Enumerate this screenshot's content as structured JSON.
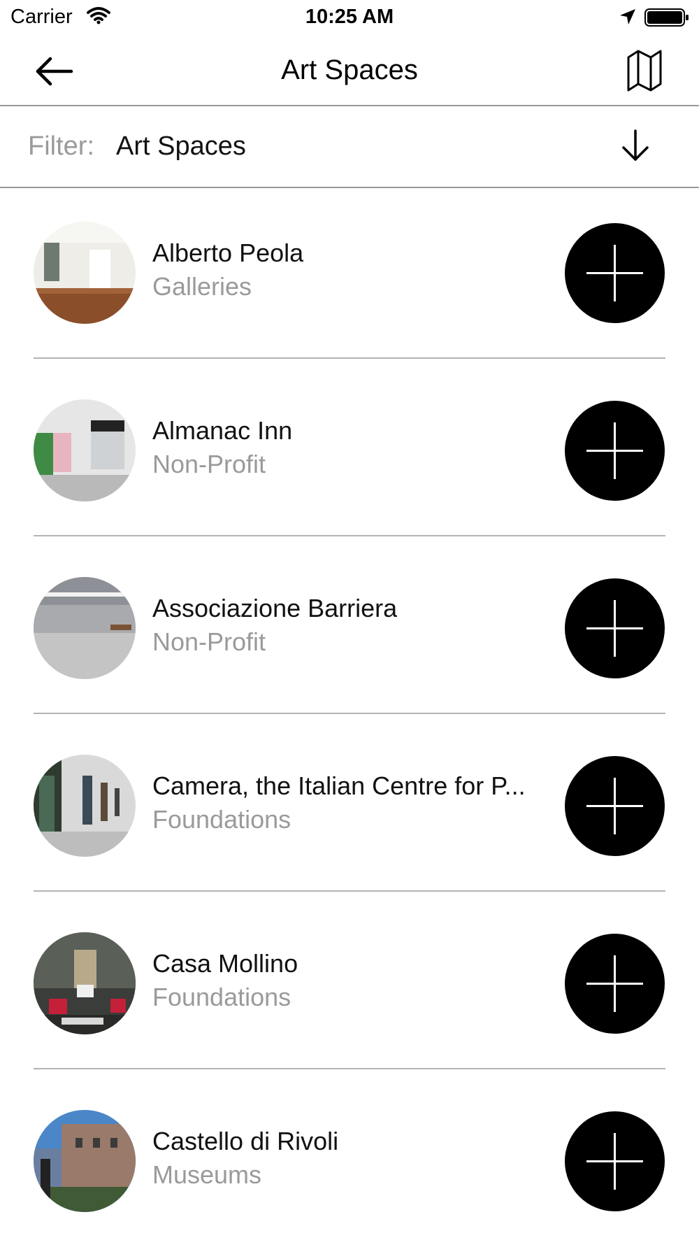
{
  "status_bar": {
    "carrier": "Carrier",
    "time": "10:25 AM"
  },
  "nav": {
    "title": "Art Spaces",
    "back_icon": "back-arrow-icon",
    "map_icon": "map-icon"
  },
  "filter": {
    "label": "Filter:",
    "value": "Art Spaces",
    "toggle_icon": "arrow-down-icon"
  },
  "colors": {
    "text_primary": "#111111",
    "text_secondary": "#9a9a9a",
    "divider": "#b3b3b3",
    "add_button": "#000000"
  },
  "items": [
    {
      "name": "Alberto Peola",
      "category": "Galleries"
    },
    {
      "name": "Almanac Inn",
      "category": "Non-Profit"
    },
    {
      "name": "Associazione Barriera",
      "category": "Non-Profit"
    },
    {
      "name": "Camera, the Italian Centre for P...",
      "category": "Foundations"
    },
    {
      "name": "Casa Mollino",
      "category": "Foundations"
    },
    {
      "name": "Castello di Rivoli",
      "category": "Museums"
    }
  ]
}
